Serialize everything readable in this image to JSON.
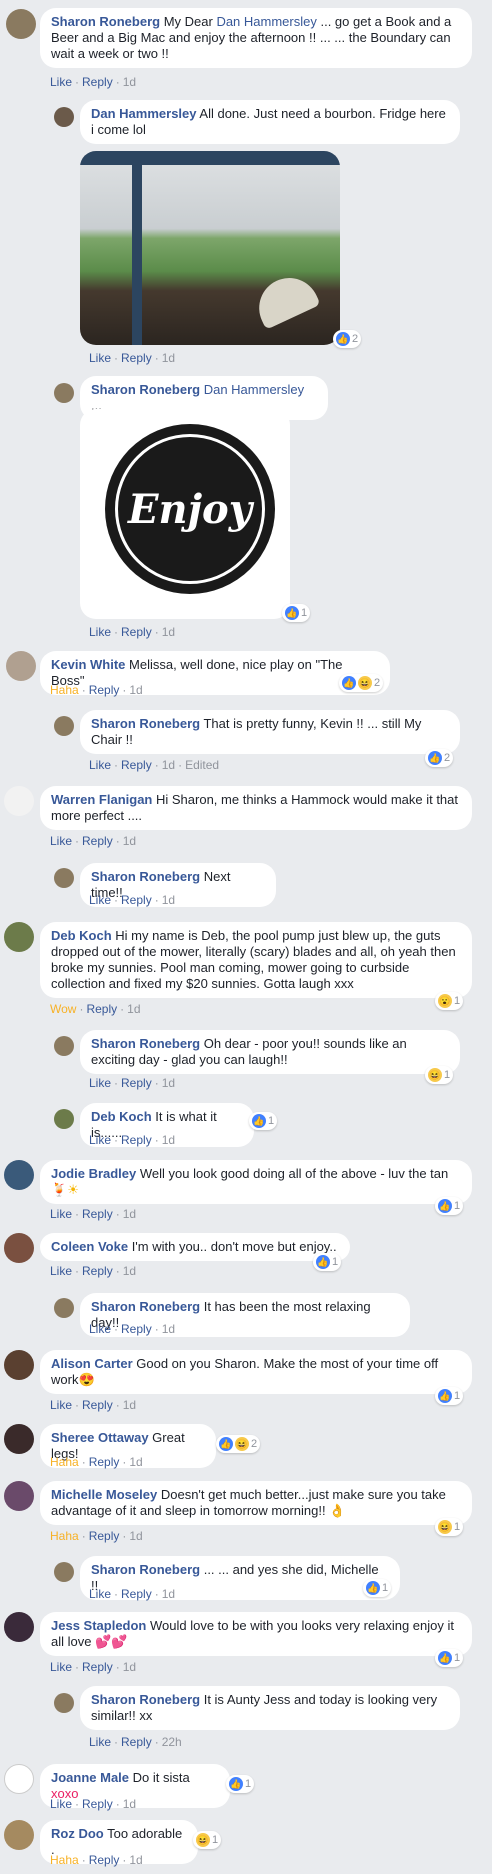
{
  "actions": {
    "like": "Like",
    "haha": "Haha",
    "wow": "Wow",
    "reply": "Reply",
    "edited": "Edited",
    "sep": "·"
  },
  "comments": [
    {
      "author": "Sharon Roneberg",
      "pre": "My Dear ",
      "mention": "Dan Hammersley",
      "text": " ... go get a Book and a Beer and a Big Mac and enjoy the afternoon !! ... ... the Boundary can wait a week or two !!",
      "time": "1d"
    },
    {
      "author": "Dan Hammersley",
      "text": "All done. Just need a bourbon. Fridge here i come lol",
      "time": "1d",
      "reactions": "2"
    },
    {
      "author": "Sharon Roneberg",
      "mention": "Dan Hammersley",
      "text": " ...",
      "time": "1d",
      "reactions": "1",
      "image_text": "Enjoy"
    },
    {
      "author": "Kevin White",
      "text": "Melissa, well done, nice play on \"The Boss\"",
      "time": "1d",
      "reactions": "2"
    },
    {
      "author": "Sharon Roneberg",
      "text": "That is pretty funny, Kevin !! ... still My Chair !!",
      "time": "1d",
      "reactions": "2"
    },
    {
      "author": "Warren Flanigan",
      "text": "Hi Sharon, me thinks a Hammock would make it that more perfect ....",
      "time": "1d"
    },
    {
      "author": "Sharon Roneberg",
      "text": "Next time!!",
      "time": "1d"
    },
    {
      "author": "Deb Koch",
      "text": "Hi my name is Deb, the pool pump just blew up, the guts dropped out of the mower, literally (scary) blades and all, oh yeah then broke my sunnies. Pool man coming, mower going to curbside collection and fixed my $20 sunnies. Gotta laugh xxx",
      "time": "1d",
      "reactions": "1"
    },
    {
      "author": "Sharon Roneberg",
      "text": "Oh dear - poor you!! sounds like an exciting day - glad you can laugh!!",
      "time": "1d",
      "reactions": "1"
    },
    {
      "author": "Deb Koch",
      "text": "It is what it is......",
      "time": "1d",
      "reactions": "1"
    },
    {
      "author": "Jodie Bradley",
      "text": "Well you look good doing all of the above - luv the tan",
      "time": "1d",
      "reactions": "1"
    },
    {
      "author": "Coleen Voke",
      "text": "I'm with you.. don't move but enjoy..",
      "time": "1d",
      "reactions": "1"
    },
    {
      "author": "Sharon Roneberg",
      "text": "It has been the most relaxing day!!",
      "time": "1d"
    },
    {
      "author": "Alison Carter",
      "text": "Good on you Sharon. Make the most of your time off work",
      "time": "1d",
      "reactions": "1"
    },
    {
      "author": "Sheree Ottaway",
      "text": "Great legs!",
      "time": "1d",
      "reactions": "2"
    },
    {
      "author": "Michelle Moseley",
      "text": "Doesn't get much better...just make sure you take advantage of it and sleep in tomorrow morning!!",
      "time": "1d",
      "reactions": "1"
    },
    {
      "author": "Sharon Roneberg",
      "text": "... ... and yes she did, Michelle !!",
      "time": "1d",
      "reactions": "1"
    },
    {
      "author": "Jess Stapledon",
      "text": "Would love to be with you looks very relaxing enjoy it all love",
      "time": "1d",
      "reactions": "1"
    },
    {
      "author": "Sharon Roneberg",
      "text": "It is Aunty Jess and today is looking very similar!! xx",
      "time": "22h"
    },
    {
      "author": "Joanne Male",
      "text": "Do it sista ",
      "xo": "xoxo",
      "time": "1d",
      "reactions": "1"
    },
    {
      "author": "Roz Doo",
      "text": "Too adorable .",
      "time": "1d",
      "reactions": "1"
    }
  ],
  "colors": {
    "background": "#e9ebee",
    "name": "#385898",
    "muted": "#90949c",
    "haha": "#f7b125",
    "like": "#4080ff"
  }
}
